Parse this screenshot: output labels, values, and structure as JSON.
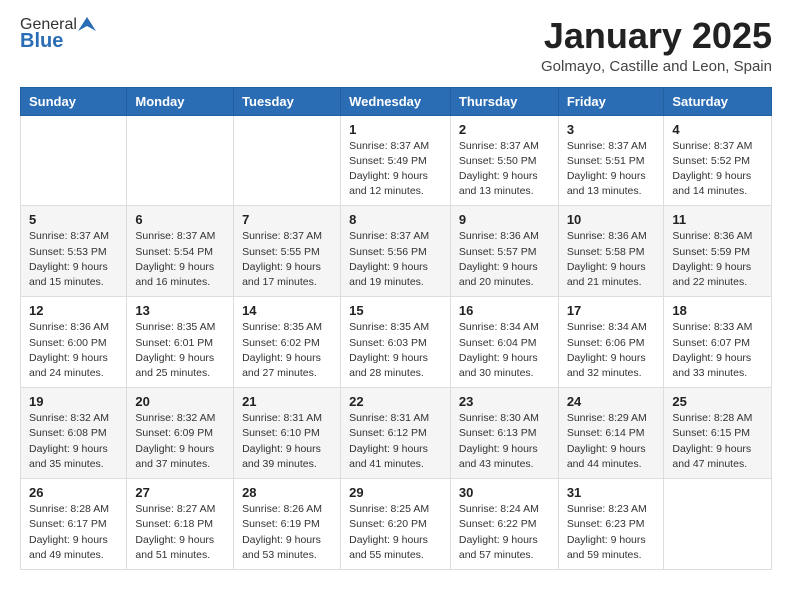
{
  "logo": {
    "general": "General",
    "blue": "Blue"
  },
  "title": "January 2025",
  "location": "Golmayo, Castille and Leon, Spain",
  "days_of_week": [
    "Sunday",
    "Monday",
    "Tuesday",
    "Wednesday",
    "Thursday",
    "Friday",
    "Saturday"
  ],
  "weeks": [
    [
      {
        "day": "",
        "detail": ""
      },
      {
        "day": "",
        "detail": ""
      },
      {
        "day": "",
        "detail": ""
      },
      {
        "day": "1",
        "detail": "Sunrise: 8:37 AM\nSunset: 5:49 PM\nDaylight: 9 hours and 12 minutes."
      },
      {
        "day": "2",
        "detail": "Sunrise: 8:37 AM\nSunset: 5:50 PM\nDaylight: 9 hours and 13 minutes."
      },
      {
        "day": "3",
        "detail": "Sunrise: 8:37 AM\nSunset: 5:51 PM\nDaylight: 9 hours and 13 minutes."
      },
      {
        "day": "4",
        "detail": "Sunrise: 8:37 AM\nSunset: 5:52 PM\nDaylight: 9 hours and 14 minutes."
      }
    ],
    [
      {
        "day": "5",
        "detail": "Sunrise: 8:37 AM\nSunset: 5:53 PM\nDaylight: 9 hours and 15 minutes."
      },
      {
        "day": "6",
        "detail": "Sunrise: 8:37 AM\nSunset: 5:54 PM\nDaylight: 9 hours and 16 minutes."
      },
      {
        "day": "7",
        "detail": "Sunrise: 8:37 AM\nSunset: 5:55 PM\nDaylight: 9 hours and 17 minutes."
      },
      {
        "day": "8",
        "detail": "Sunrise: 8:37 AM\nSunset: 5:56 PM\nDaylight: 9 hours and 19 minutes."
      },
      {
        "day": "9",
        "detail": "Sunrise: 8:36 AM\nSunset: 5:57 PM\nDaylight: 9 hours and 20 minutes."
      },
      {
        "day": "10",
        "detail": "Sunrise: 8:36 AM\nSunset: 5:58 PM\nDaylight: 9 hours and 21 minutes."
      },
      {
        "day": "11",
        "detail": "Sunrise: 8:36 AM\nSunset: 5:59 PM\nDaylight: 9 hours and 22 minutes."
      }
    ],
    [
      {
        "day": "12",
        "detail": "Sunrise: 8:36 AM\nSunset: 6:00 PM\nDaylight: 9 hours and 24 minutes."
      },
      {
        "day": "13",
        "detail": "Sunrise: 8:35 AM\nSunset: 6:01 PM\nDaylight: 9 hours and 25 minutes."
      },
      {
        "day": "14",
        "detail": "Sunrise: 8:35 AM\nSunset: 6:02 PM\nDaylight: 9 hours and 27 minutes."
      },
      {
        "day": "15",
        "detail": "Sunrise: 8:35 AM\nSunset: 6:03 PM\nDaylight: 9 hours and 28 minutes."
      },
      {
        "day": "16",
        "detail": "Sunrise: 8:34 AM\nSunset: 6:04 PM\nDaylight: 9 hours and 30 minutes."
      },
      {
        "day": "17",
        "detail": "Sunrise: 8:34 AM\nSunset: 6:06 PM\nDaylight: 9 hours and 32 minutes."
      },
      {
        "day": "18",
        "detail": "Sunrise: 8:33 AM\nSunset: 6:07 PM\nDaylight: 9 hours and 33 minutes."
      }
    ],
    [
      {
        "day": "19",
        "detail": "Sunrise: 8:32 AM\nSunset: 6:08 PM\nDaylight: 9 hours and 35 minutes."
      },
      {
        "day": "20",
        "detail": "Sunrise: 8:32 AM\nSunset: 6:09 PM\nDaylight: 9 hours and 37 minutes."
      },
      {
        "day": "21",
        "detail": "Sunrise: 8:31 AM\nSunset: 6:10 PM\nDaylight: 9 hours and 39 minutes."
      },
      {
        "day": "22",
        "detail": "Sunrise: 8:31 AM\nSunset: 6:12 PM\nDaylight: 9 hours and 41 minutes."
      },
      {
        "day": "23",
        "detail": "Sunrise: 8:30 AM\nSunset: 6:13 PM\nDaylight: 9 hours and 43 minutes."
      },
      {
        "day": "24",
        "detail": "Sunrise: 8:29 AM\nSunset: 6:14 PM\nDaylight: 9 hours and 44 minutes."
      },
      {
        "day": "25",
        "detail": "Sunrise: 8:28 AM\nSunset: 6:15 PM\nDaylight: 9 hours and 47 minutes."
      }
    ],
    [
      {
        "day": "26",
        "detail": "Sunrise: 8:28 AM\nSunset: 6:17 PM\nDaylight: 9 hours and 49 minutes."
      },
      {
        "day": "27",
        "detail": "Sunrise: 8:27 AM\nSunset: 6:18 PM\nDaylight: 9 hours and 51 minutes."
      },
      {
        "day": "28",
        "detail": "Sunrise: 8:26 AM\nSunset: 6:19 PM\nDaylight: 9 hours and 53 minutes."
      },
      {
        "day": "29",
        "detail": "Sunrise: 8:25 AM\nSunset: 6:20 PM\nDaylight: 9 hours and 55 minutes."
      },
      {
        "day": "30",
        "detail": "Sunrise: 8:24 AM\nSunset: 6:22 PM\nDaylight: 9 hours and 57 minutes."
      },
      {
        "day": "31",
        "detail": "Sunrise: 8:23 AM\nSunset: 6:23 PM\nDaylight: 9 hours and 59 minutes."
      },
      {
        "day": "",
        "detail": ""
      }
    ]
  ]
}
